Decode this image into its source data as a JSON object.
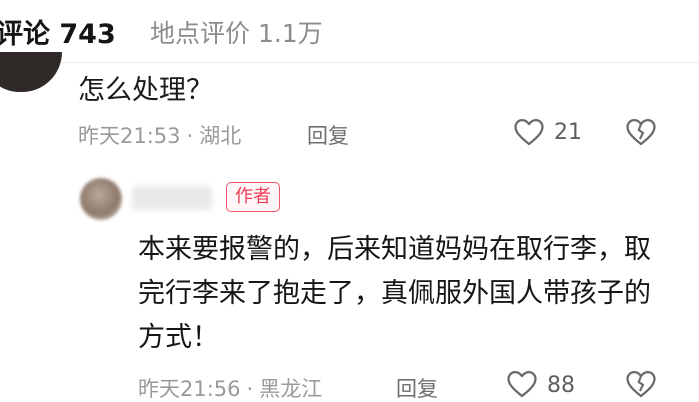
{
  "tabs": {
    "comments_label": "评论 743",
    "reviews_label": "地点评价 1.1万"
  },
  "comment": {
    "text": "怎么处理？",
    "time": "昨天21:53",
    "location": "湖北",
    "reply_label": "回复",
    "likes": "21"
  },
  "reply": {
    "badge": "作者",
    "text": "本来要报警的，后来知道妈妈在取行李，取完行李来了抱走了，真佩服外国人带孩子的方式！",
    "time": "昨天21:56",
    "location": "黑龙江",
    "reply_label": "回复",
    "likes": "88"
  },
  "separator": "·",
  "colors": {
    "badge": "#ef3f57",
    "meta": "#9a9a9a"
  },
  "icons": [
    "heart-outline-icon",
    "broken-heart-icon"
  ]
}
